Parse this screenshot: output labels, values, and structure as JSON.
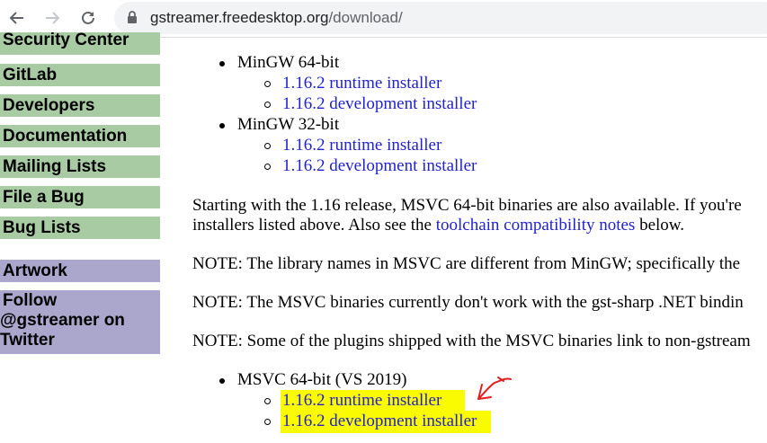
{
  "browser": {
    "url_host": "gstreamer.freedesktop.org",
    "url_path": "/download/"
  },
  "sidebar": {
    "items": [
      {
        "label": "Security Center"
      },
      {
        "label": "GitLab"
      },
      {
        "label": "Developers"
      },
      {
        "label": "Documentation"
      },
      {
        "label": "Mailing Lists"
      },
      {
        "label": "File a Bug"
      },
      {
        "label": "Bug Lists"
      },
      {
        "label": "Artwork"
      },
      {
        "label": "Follow @gstreamer on Twitter",
        "lines": [
          "Follow",
          "@gstreamer on",
          "Twitter"
        ]
      }
    ]
  },
  "content": {
    "mingw64": {
      "label": "MinGW 64-bit",
      "runtime": "1.16.2 runtime installer",
      "development": "1.16.2 development installer"
    },
    "mingw32": {
      "label": "MinGW 32-bit",
      "runtime": "1.16.2 runtime installer",
      "development": "1.16.2 development installer"
    },
    "msvc_intro": {
      "line1": "Starting with the 1.16 release, MSVC 64-bit binaries are also available. If you're",
      "line2_before": "installers listed above. Also see the ",
      "line2_link": "toolchain compatibility notes",
      "line2_after": " below."
    },
    "notes": [
      "NOTE: The library names in MSVC are different from MinGW; specifically the",
      "NOTE: The MSVC binaries currently don't work with the gst-sharp .NET bindin",
      "NOTE: Some of the plugins shipped with the MSVC binaries link to non-gstream"
    ],
    "msvc64": {
      "label": "MSVC 64-bit (VS 2019)",
      "runtime": "1.16.2 runtime installer",
      "development": "1.16.2 development installer"
    }
  },
  "colors": {
    "sidebar_green": "#a8cba4",
    "sidebar_purple": "#aaa6cc",
    "link": "#2222cc",
    "highlight": "#fbfb00",
    "annotation": "#e02020"
  }
}
